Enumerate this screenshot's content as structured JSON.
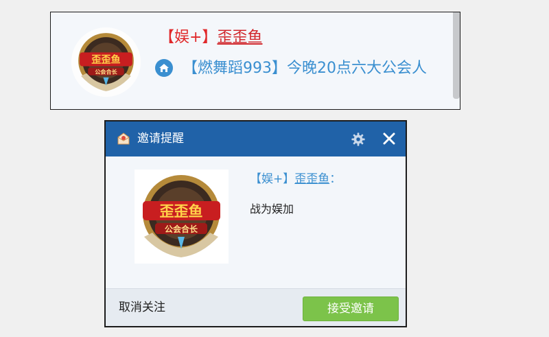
{
  "top_card": {
    "name_prefix": "【娱+】",
    "name_user": "歪歪鱼",
    "message": "【燃舞蹈993】今晚20点六大公会人",
    "home_icon": "home-icon",
    "avatar": {
      "emblem_lines": [
        "歪歪鱼",
        "公会合长"
      ]
    }
  },
  "popup": {
    "title": "邀请提醒",
    "app_icon": "envelope-icon",
    "settings_icon": "gear-icon",
    "close_icon": "close-icon",
    "sender_prefix": "【娱+】",
    "sender_user": "歪歪鱼",
    "sender_suffix": "：",
    "body_text": "战为娱加",
    "unfollow_label": "取消关注",
    "accept_label": "接受邀请"
  },
  "colors": {
    "title_bar": "#2062a8",
    "accept_button": "#7cc34a",
    "name_red": "#d1262b",
    "link_blue": "#3a8fd0"
  }
}
